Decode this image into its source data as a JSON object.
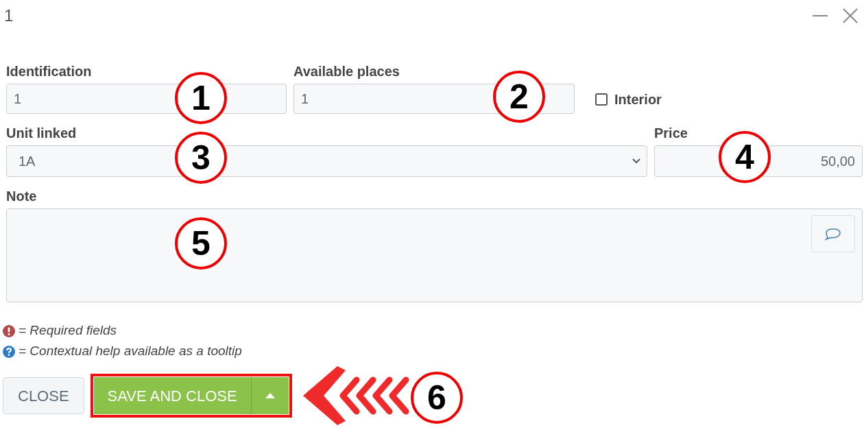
{
  "window": {
    "title": "1"
  },
  "fields": [
    {
      "kind": "text",
      "label": "Identification",
      "value": "1"
    },
    {
      "kind": "text",
      "label": "Available places",
      "value": "1"
    },
    {
      "kind": "checkbox",
      "label": "Interior",
      "checked": false
    },
    {
      "kind": "select",
      "label": "Unit linked",
      "value": "1A"
    },
    {
      "kind": "number",
      "label": "Price",
      "value": "50,00"
    },
    {
      "kind": "textarea",
      "label": "Note"
    }
  ],
  "legend": [
    {
      "kind": "required",
      "text": "= Required fields"
    },
    {
      "kind": "help",
      "text": "= Contextual help available as a tooltip"
    }
  ],
  "buttons": [
    {
      "kind": "plain",
      "label": "CLOSE"
    },
    {
      "kind": "primary",
      "label": "SAVE AND CLOSE"
    }
  ],
  "callouts": [
    "1",
    "2",
    "3",
    "4",
    "5",
    "6"
  ]
}
